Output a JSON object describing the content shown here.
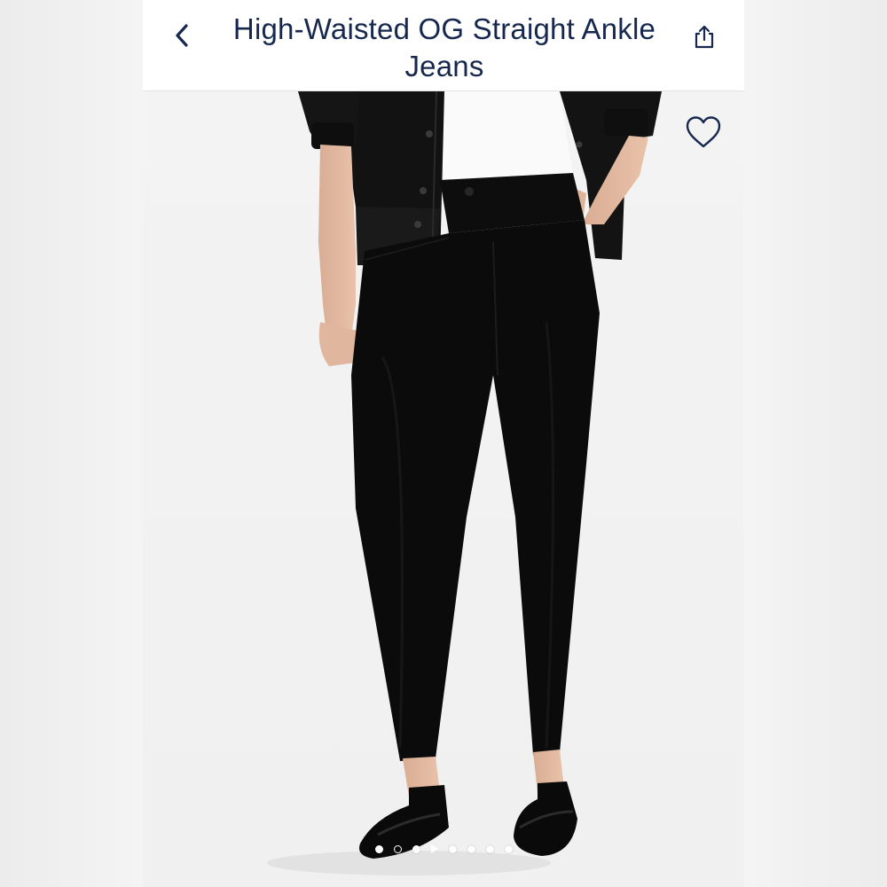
{
  "header": {
    "back_icon": "chevron-left-icon",
    "title": "High-Waisted OG Straight Ankle Jeans",
    "share_icon": "share-icon"
  },
  "product": {
    "favorite_icon": "heart-outline-icon"
  },
  "carousel": {
    "slide_count": 8,
    "active_index": 0,
    "dot_kinds": [
      "dot",
      "outline",
      "dot",
      "play",
      "dot",
      "dot",
      "dot",
      "dot"
    ]
  },
  "colors": {
    "title_text": "#17284f",
    "header_bg": "#ffffff",
    "jeans": "#0b0b0b"
  }
}
